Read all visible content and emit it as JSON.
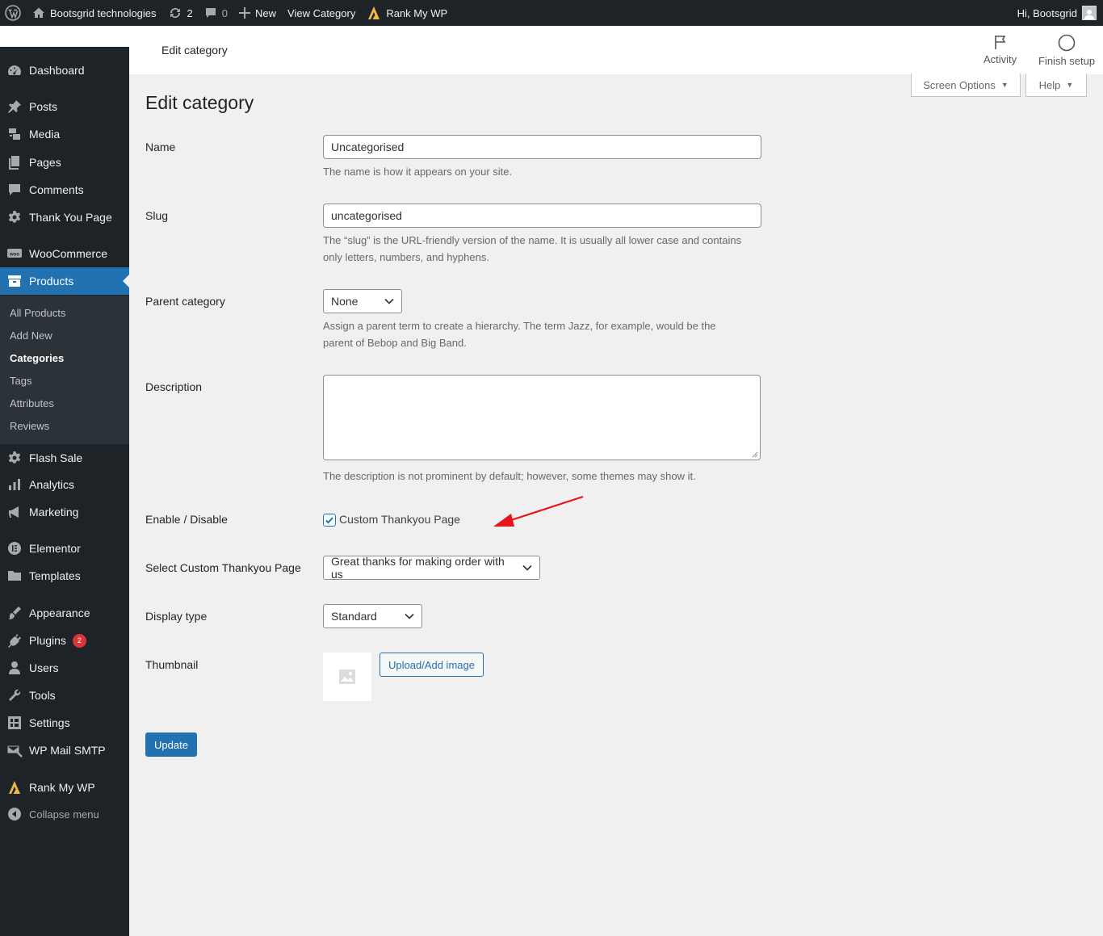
{
  "adminbar": {
    "site_name": "Bootsgrid technologies",
    "updates_count": "2",
    "comments_count": "0",
    "new_label": "New",
    "view_category_label": "View Category",
    "rank_label": "Rank My WP",
    "greeting": "Hi, Bootsgrid"
  },
  "sidebar": {
    "items": [
      {
        "label": "Dashboard",
        "icon": "dashboard-icon"
      },
      {
        "label": "Posts",
        "icon": "pin-icon"
      },
      {
        "label": "Media",
        "icon": "media-icon"
      },
      {
        "label": "Pages",
        "icon": "pages-icon"
      },
      {
        "label": "Comments",
        "icon": "comments-icon"
      },
      {
        "label": "Thank You Page",
        "icon": "gear-icon"
      },
      {
        "label": "WooCommerce",
        "icon": "woo-icon"
      },
      {
        "label": "Products",
        "icon": "archive-icon"
      },
      {
        "label": "Flash Sale",
        "icon": "gear-icon"
      },
      {
        "label": "Analytics",
        "icon": "bar-chart-icon"
      },
      {
        "label": "Marketing",
        "icon": "megaphone-icon"
      },
      {
        "label": "Elementor",
        "icon": "elementor-icon"
      },
      {
        "label": "Templates",
        "icon": "folder-icon"
      },
      {
        "label": "Appearance",
        "icon": "brush-icon"
      },
      {
        "label": "Plugins",
        "icon": "plug-icon"
      },
      {
        "label": "Users",
        "icon": "user-icon"
      },
      {
        "label": "Tools",
        "icon": "wrench-icon"
      },
      {
        "label": "Settings",
        "icon": "settings-icon"
      },
      {
        "label": "WP Mail SMTP",
        "icon": "mail-icon"
      },
      {
        "label": "Rank My WP",
        "icon": "rank-icon"
      }
    ],
    "plugins_badge": "2",
    "submenu": [
      "All Products",
      "Add New",
      "Categories",
      "Tags",
      "Attributes",
      "Reviews"
    ],
    "collapse_label": "Collapse menu"
  },
  "header": {
    "title": "Edit category",
    "activity_label": "Activity",
    "finish_setup_label": "Finish setup",
    "screen_options_label": "Screen Options",
    "help_label": "Help"
  },
  "form": {
    "page_title": "Edit category",
    "name_label": "Name",
    "name_value": "Uncategorised",
    "name_desc": "The name is how it appears on your site.",
    "slug_label": "Slug",
    "slug_value": "uncategorised",
    "slug_desc": "The “slug” is the URL-friendly version of the name. It is usually all lower case and contains only letters, numbers, and hyphens.",
    "parent_label": "Parent category",
    "parent_value": "None",
    "parent_desc": "Assign a parent term to create a hierarchy. The term Jazz, for example, would be the parent of Bebop and Big Band.",
    "description_label": "Description",
    "description_desc": "The description is not prominent by default; however, some themes may show it.",
    "enable_label": "Enable / Disable",
    "enable_checkbox_label": "Custom Thankyou Page",
    "enable_checked": true,
    "thankyou_label": "Select Custom Thankyou Page",
    "thankyou_value": "Great thanks for making order with us",
    "display_label": "Display type",
    "display_value": "Standard",
    "thumbnail_label": "Thumbnail",
    "upload_label": "Upload/Add image",
    "update_label": "Update"
  },
  "colors": {
    "accent": "#2271b1",
    "sidebar_bg": "#1d2327",
    "annotation_arrow": "#e8121c"
  }
}
